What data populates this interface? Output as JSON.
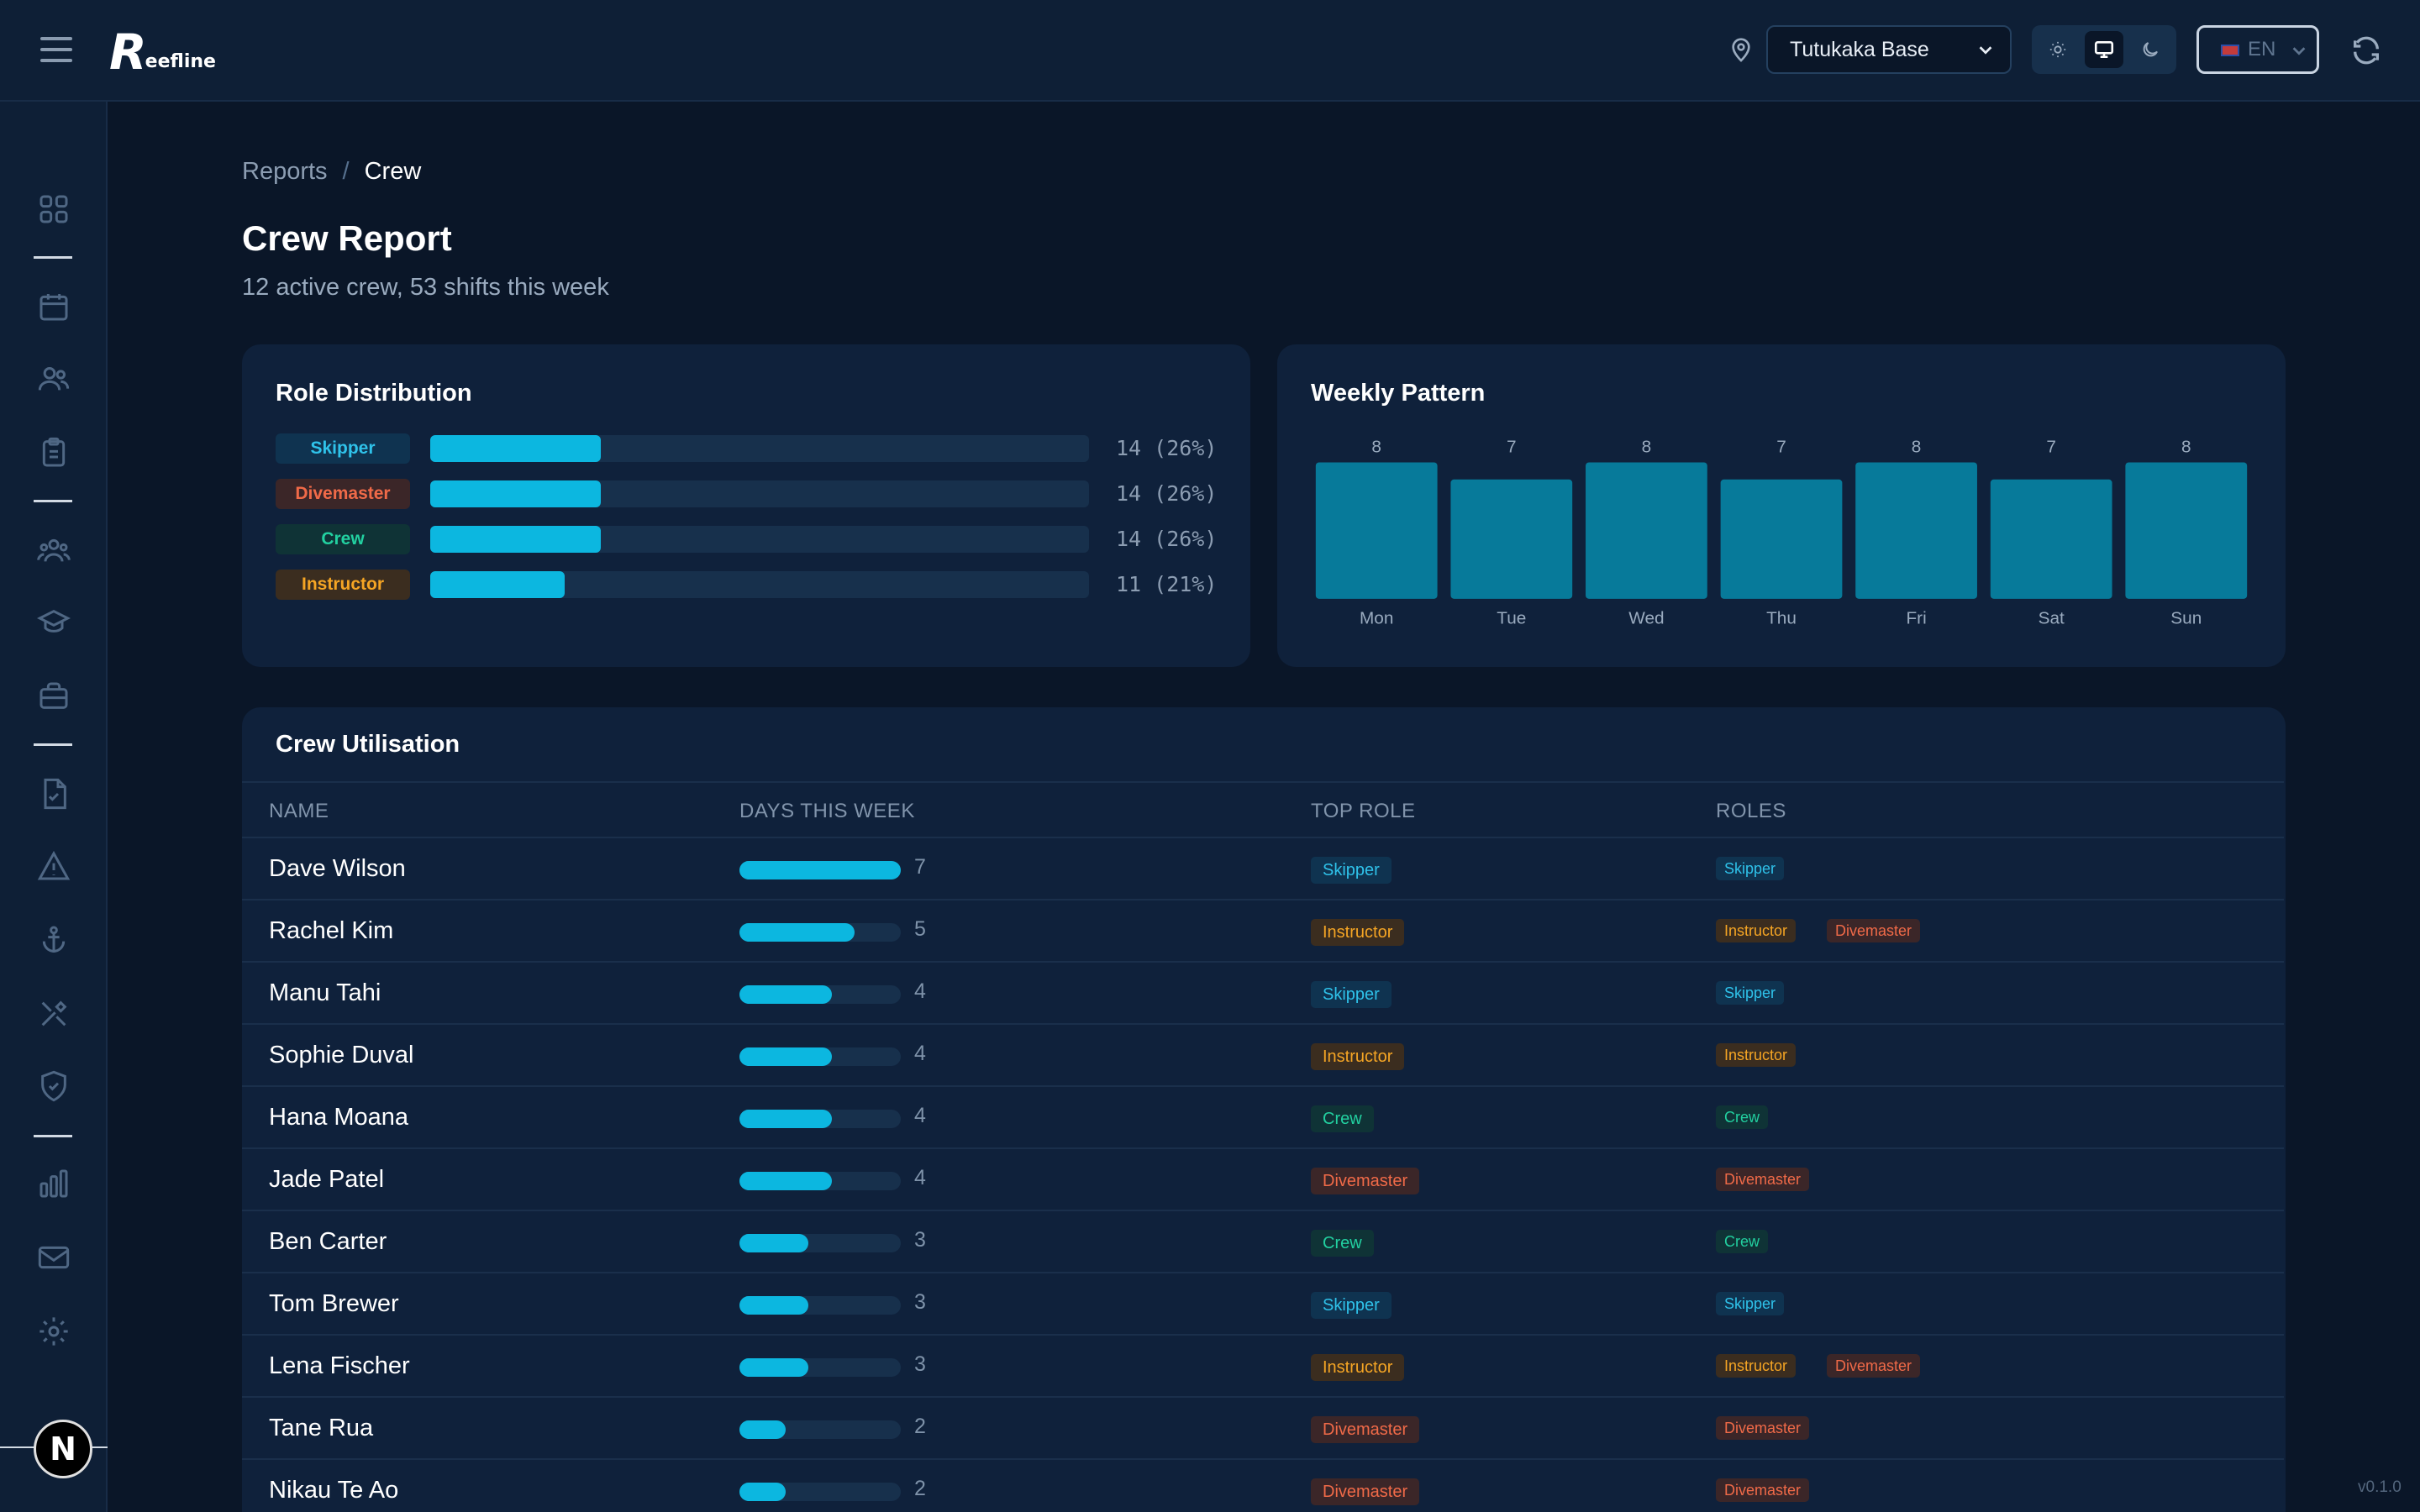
{
  "header": {
    "app_name": "Reefline",
    "logo_initial": "R",
    "logo_rest": "eefline",
    "location": "Tutukaka Base",
    "language": "EN"
  },
  "sidebar": {
    "icons": [
      "grid-icon",
      "calendar-icon",
      "users-icon",
      "clipboard-icon",
      "team-icon",
      "graduation-cap-icon",
      "briefcase-icon",
      "file-check-icon",
      "warning-icon",
      "anchor-icon",
      "tools-icon",
      "shield-check-icon",
      "bar-chart-icon",
      "mail-icon",
      "gear-icon"
    ]
  },
  "breadcrumb": {
    "parent": "Reports",
    "separator": "/",
    "current": "Crew"
  },
  "page": {
    "title": "Crew Report",
    "subtitle": "12 active crew, 53 shifts this week"
  },
  "role_distribution": {
    "title": "Role Distribution",
    "max": 54,
    "roles": [
      {
        "label": "Skipper",
        "key": "skipper",
        "count": 14,
        "pct_label": "14 (26%)",
        "fraction": 0.26
      },
      {
        "label": "Divemaster",
        "key": "divemaster",
        "count": 14,
        "pct_label": "14 (26%)",
        "fraction": 0.26
      },
      {
        "label": "Crew",
        "key": "crew",
        "count": 14,
        "pct_label": "14 (26%)",
        "fraction": 0.26
      },
      {
        "label": "Instructor",
        "key": "instructor",
        "count": 11,
        "pct_label": "11 (21%)",
        "fraction": 0.21
      }
    ]
  },
  "chart_data": {
    "type": "bar",
    "title": "Weekly Pattern",
    "categories": [
      "Mon",
      "Tue",
      "Wed",
      "Thu",
      "Fri",
      "Sat",
      "Sun"
    ],
    "values": [
      8,
      7,
      8,
      7,
      8,
      7,
      8
    ],
    "value_labels": [
      "8",
      "7",
      "8",
      "7",
      "8",
      "7",
      "8"
    ],
    "ylim": [
      0,
      8
    ],
    "grid": false,
    "bar_color": "#077a9a"
  },
  "utilisation": {
    "title": "Crew Utilisation",
    "columns": [
      "NAME",
      "DAYS THIS WEEK",
      "TOP ROLE",
      "ROLES"
    ],
    "max_days": 7,
    "rows": [
      {
        "name": "Dave Wilson",
        "days": 7,
        "days_label": "7",
        "top_role": "Skipper",
        "roles": [
          "Skipper"
        ]
      },
      {
        "name": "Rachel Kim",
        "days": 5,
        "days_label": "5",
        "top_role": "Instructor",
        "roles": [
          "Instructor",
          "Divemaster"
        ]
      },
      {
        "name": "Manu Tahi",
        "days": 4,
        "days_label": "4",
        "top_role": "Skipper",
        "roles": [
          "Skipper"
        ]
      },
      {
        "name": "Sophie Duval",
        "days": 4,
        "days_label": "4",
        "top_role": "Instructor",
        "roles": [
          "Instructor"
        ]
      },
      {
        "name": "Hana Moana",
        "days": 4,
        "days_label": "4",
        "top_role": "Crew",
        "roles": [
          "Crew"
        ]
      },
      {
        "name": "Jade Patel",
        "days": 4,
        "days_label": "4",
        "top_role": "Divemaster",
        "roles": [
          "Divemaster"
        ]
      },
      {
        "name": "Ben Carter",
        "days": 3,
        "days_label": "3",
        "top_role": "Crew",
        "roles": [
          "Crew"
        ]
      },
      {
        "name": "Tom Brewer",
        "days": 3,
        "days_label": "3",
        "top_role": "Skipper",
        "roles": [
          "Skipper"
        ]
      },
      {
        "name": "Lena Fischer",
        "days": 3,
        "days_label": "3",
        "top_role": "Instructor",
        "roles": [
          "Instructor",
          "Divemaster"
        ]
      },
      {
        "name": "Tane Rua",
        "days": 2,
        "days_label": "2",
        "top_role": "Divemaster",
        "roles": [
          "Divemaster"
        ]
      },
      {
        "name": "Nikau Te Ao",
        "days": 2,
        "days_label": "2",
        "top_role": "Divemaster",
        "roles": [
          "Divemaster"
        ]
      }
    ]
  },
  "colors": {
    "accent": "#0cb7e0",
    "skipper": "#2fc2ea",
    "instructor": "#f5a524",
    "divemaster": "#f06a48",
    "crew": "#22d0a0"
  },
  "footer": {
    "version": "v0.1.0",
    "framework_badge": "N"
  }
}
